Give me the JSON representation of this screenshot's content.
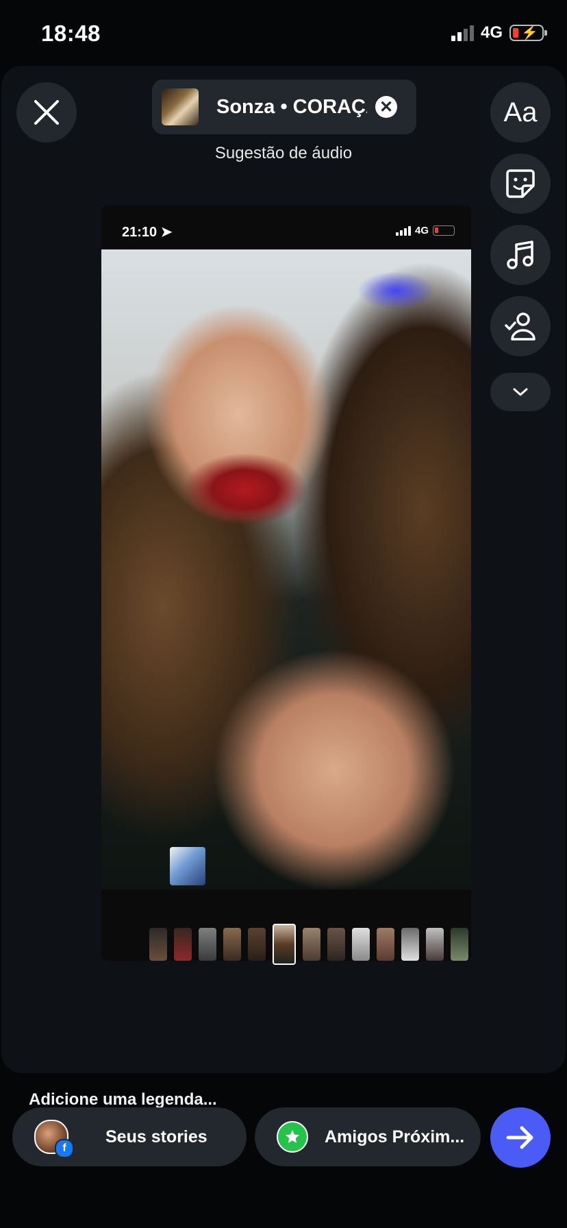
{
  "status_bar": {
    "time": "18:48",
    "network": "4G",
    "battery_level": 0.15,
    "charging": true
  },
  "header": {
    "audio_title": "Sonza • CORAÇÃO",
    "audio_hint": "Sugestão de áudio"
  },
  "tools": [
    {
      "name": "text",
      "label": "Aa"
    },
    {
      "name": "sticker-icon"
    },
    {
      "name": "music-icon"
    },
    {
      "name": "tag-people-icon"
    },
    {
      "name": "chevron-down-icon"
    }
  ],
  "preview": {
    "status_time": "21:10",
    "status_network": "4G"
  },
  "caption": {
    "placeholder": "Adicione uma legenda..."
  },
  "share": {
    "stories_label": "Seus stories",
    "close_friends_label": "Amigos Próxim..."
  },
  "colors": {
    "next_button": "#4a5cf5",
    "close_friends": "#24c34a",
    "facebook": "#1877f2"
  }
}
